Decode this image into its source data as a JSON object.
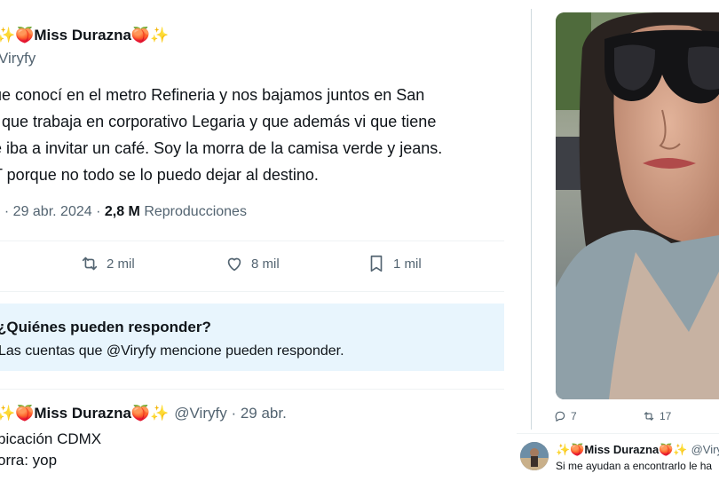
{
  "main_tweet": {
    "author_name": "✨🍑Miss Durazna🍑✨",
    "author_handle": "Viryfy",
    "body_lines": [
      "ue conocí en el metro Refineria y nos bajamos juntos en San",
      ", que trabaja en corporativo Legaria y que además vi que tiene",
      "e iba a invitar un café. Soy la morra de la camisa verde y jeans.",
      "T porque no todo se lo puedo dejar al destino."
    ],
    "meta_time": ". · 29 abr. 2024 · ",
    "meta_views_count": "2,8 M",
    "meta_views_label": " Reproducciones",
    "actions": {
      "retweets": "2 mil",
      "likes": "8 mil",
      "bookmarks": "1 mil"
    }
  },
  "reply_restriction": {
    "title": "¿Quiénes pueden responder?",
    "subtitle": "Las cuentas que @Viryfy mencione pueden responder."
  },
  "second_tweet": {
    "author_name": "✨🍑Miss Durazna🍑✨",
    "author_handle": "@Viryfy · 29 abr.",
    "line1": "bicación CDMX",
    "line2": "orra: yop"
  },
  "right_panel": {
    "replies": "7",
    "retweets": "17",
    "author_name": "✨🍑Miss Durazna🍑✨",
    "author_handle": "@Viry",
    "text": "Si me ayudan a encontrarlo le ha"
  },
  "colors": {
    "text": "#0f1419",
    "secondary": "#536471",
    "reply_box_bg": "#e8f5fd",
    "divider": "#eff3f4"
  }
}
